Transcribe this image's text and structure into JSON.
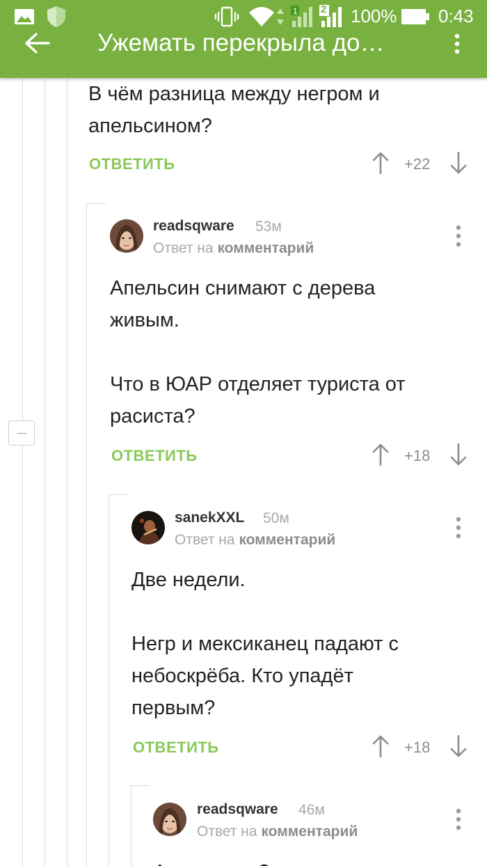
{
  "status_bar": {
    "battery": "100%",
    "time": "0:43",
    "sim2_label": "2"
  },
  "app_bar": {
    "title": "Ужемать перекрыла до…"
  },
  "colors": {
    "brand": "#78b13f",
    "reply_link": "#8ac858",
    "thread_line": "#d9d9d9"
  },
  "comments": [
    {
      "text": "В чём разница между негром и\nапельсином?",
      "reply_label": "ОТВЕТИТЬ",
      "score": "+22"
    },
    {
      "author": "readsqware",
      "time": "53м",
      "reply_prefix": "Ответ на",
      "reply_target": "комментарий",
      "text": "Апельсин снимают с дерева\nживым.\n\nЧто в ЮАР отделяет туриста от\nрасиста?",
      "reply_label": "ОТВЕТИТЬ",
      "score": "+18"
    },
    {
      "author": "sanekXXL",
      "time": "50м",
      "reply_prefix": "Ответ на",
      "reply_target": "комментарий",
      "text": "Две недели.\n\nНегр и мексиканец падают с\nнебоскрёба. Кто упадёт\nпервым?",
      "reply_label": "ОТВЕТИТЬ",
      "score": "+18"
    },
    {
      "author": "readsqware",
      "time": "46м",
      "reply_prefix": "Ответ на",
      "reply_target": "комментарий",
      "text": "А кто знает?"
    }
  ]
}
